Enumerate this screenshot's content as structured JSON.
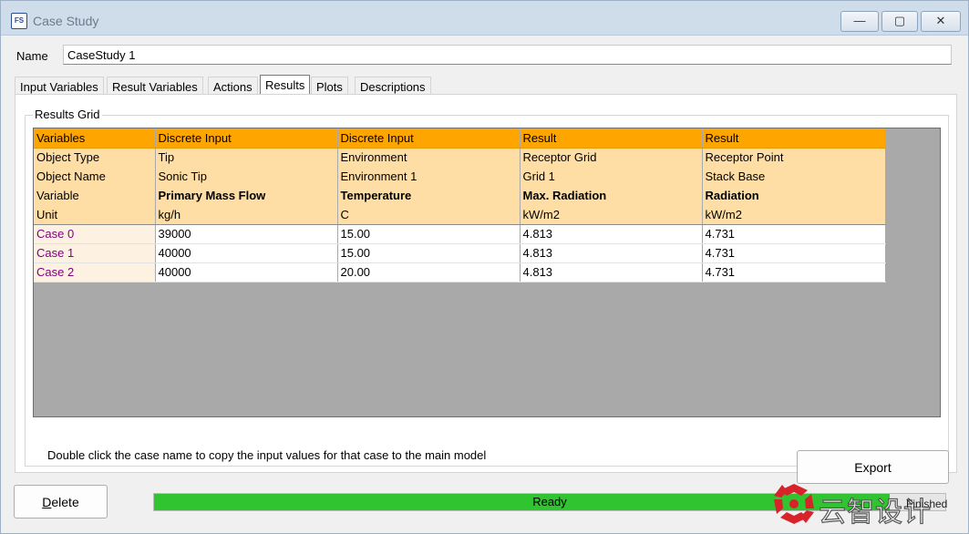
{
  "window": {
    "title": "Case Study",
    "icon_text": "FS",
    "controls": {
      "minimize": "—",
      "maximize": "▢",
      "close": "✕"
    }
  },
  "name_field": {
    "label": "Name",
    "value": "CaseStudy 1"
  },
  "tabs": [
    {
      "label": "Input Variables",
      "active": false
    },
    {
      "label": "Result Variables",
      "active": false
    },
    {
      "label": "Actions",
      "active": false
    },
    {
      "label": "Results",
      "active": true
    },
    {
      "label": "Plots",
      "active": false
    },
    {
      "label": "Descriptions",
      "active": false
    }
  ],
  "results_grid": {
    "group_title": "Results Grid",
    "header_rows": [
      {
        "label": "Variables",
        "cells": [
          "Discrete Input",
          "Discrete Input",
          "Result",
          "Result"
        ]
      },
      {
        "label": "Object Type",
        "cells": [
          "Tip",
          "Environment",
          "Receptor Grid",
          "Receptor Point"
        ]
      },
      {
        "label": "Object Name",
        "cells": [
          "Sonic Tip",
          "Environment 1",
          "Grid 1",
          "Stack Base"
        ]
      },
      {
        "label": "Variable",
        "cells": [
          "Primary Mass Flow",
          "Temperature",
          "Max. Radiation",
          "Radiation"
        ]
      },
      {
        "label": "Unit",
        "cells": [
          "kg/h",
          "C",
          "kW/m2",
          "kW/m2"
        ]
      }
    ],
    "rows": [
      {
        "case": "Case 0",
        "values": [
          "39000",
          "15.00",
          "4.813",
          "4.731"
        ]
      },
      {
        "case": "Case 1",
        "values": [
          "40000",
          "15.00",
          "4.813",
          "4.731"
        ]
      },
      {
        "case": "Case 2",
        "values": [
          "40000",
          "20.00",
          "4.813",
          "4.731"
        ]
      }
    ]
  },
  "hint_text": "Double click the case name to copy the input values for that case to the main model",
  "export_label": "Export",
  "delete_label": {
    "u": "D",
    "rest": "elete"
  },
  "status": {
    "text": "Ready",
    "progress": 0.93
  },
  "watermark": {
    "text": "云智设计",
    "small": "Finished"
  },
  "colors": {
    "header_top": "#ffa500",
    "header_light": "#ffdea6",
    "case_name": "#800080",
    "progress_fill": "#2fc430",
    "logo_red": "#d8232a"
  }
}
